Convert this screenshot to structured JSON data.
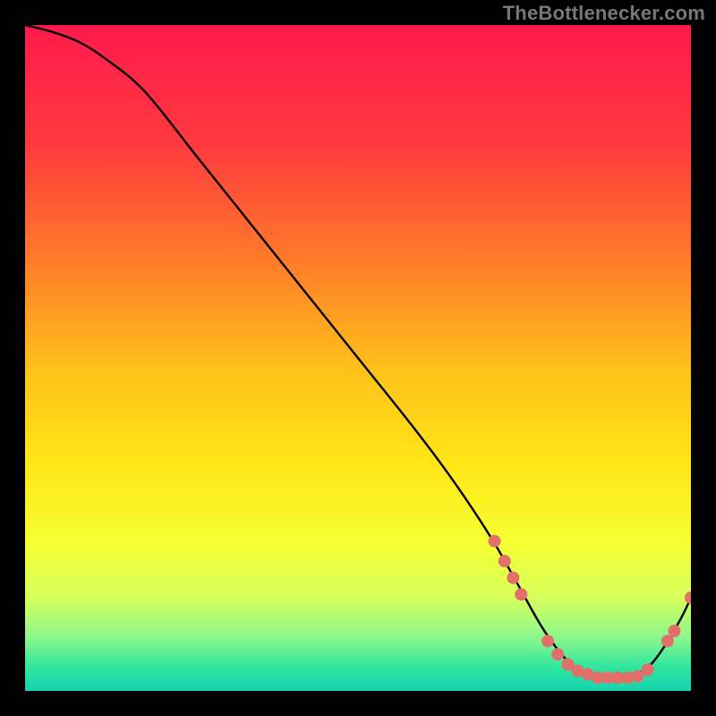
{
  "watermark": "TheBottlenecker.com",
  "gradient": {
    "stops": [
      {
        "offset": 0.0,
        "color": "#ff1a4c"
      },
      {
        "offset": 0.18,
        "color": "#ff3a3e"
      },
      {
        "offset": 0.35,
        "color": "#ff7a2a"
      },
      {
        "offset": 0.52,
        "color": "#ffc21a"
      },
      {
        "offset": 0.66,
        "color": "#ffe617"
      },
      {
        "offset": 0.78,
        "color": "#f6ff33"
      },
      {
        "offset": 0.86,
        "color": "#d6ff5c"
      },
      {
        "offset": 0.92,
        "color": "#8cf78c"
      },
      {
        "offset": 0.965,
        "color": "#2fe6a0"
      },
      {
        "offset": 1.0,
        "color": "#15d4b0"
      }
    ]
  },
  "chart_data": {
    "type": "line",
    "title": "",
    "xlabel": "",
    "ylabel": "",
    "xlim": [
      0,
      100
    ],
    "ylim": [
      0,
      100
    ],
    "series": [
      {
        "name": "curve",
        "x": [
          0,
          4,
          8,
          12,
          18,
          26,
          34,
          42,
          50,
          58,
          64,
          70,
          74,
          78,
          82,
          86,
          90,
          94,
          98,
          100
        ],
        "y": [
          100,
          99,
          97.5,
          95,
          90,
          80,
          70,
          60,
          50,
          40,
          32,
          23,
          16,
          9,
          4,
          2,
          2,
          4,
          10,
          14
        ]
      }
    ],
    "markers": [
      {
        "x": 70.5,
        "y": 22.5
      },
      {
        "x": 72.0,
        "y": 19.5
      },
      {
        "x": 73.3,
        "y": 17.0
      },
      {
        "x": 74.5,
        "y": 14.5
      },
      {
        "x": 78.5,
        "y": 7.5
      },
      {
        "x": 80.0,
        "y": 5.5
      },
      {
        "x": 81.5,
        "y": 4.0
      },
      {
        "x": 83.0,
        "y": 3.0
      },
      {
        "x": 84.5,
        "y": 2.5
      },
      {
        "x": 86.0,
        "y": 2.0
      },
      {
        "x": 87.5,
        "y": 2.0
      },
      {
        "x": 89.0,
        "y": 2.0
      },
      {
        "x": 90.5,
        "y": 2.0
      },
      {
        "x": 92.0,
        "y": 2.2
      },
      {
        "x": 93.5,
        "y": 3.2
      },
      {
        "x": 96.5,
        "y": 7.5
      },
      {
        "x": 97.5,
        "y": 9.0
      },
      {
        "x": 100.0,
        "y": 14.0
      }
    ],
    "marker_color": "#e36f6a",
    "marker_radius": 7
  }
}
